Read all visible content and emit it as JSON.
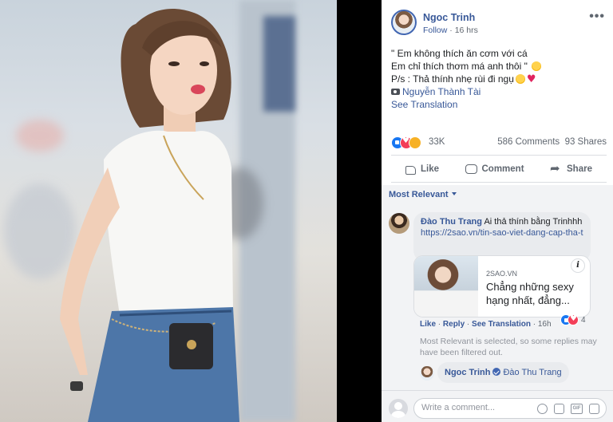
{
  "post": {
    "author": "Ngoc Trinh",
    "follow_label": "Follow",
    "separator": " · ",
    "time": "16 hrs",
    "more_label": "•••",
    "lines": [
      "\" Em không thích ăn cơm với cá",
      "Em chỉ thích thơm má anh thôi \"",
      "P/s : Thả thính nhẹ rùi đi ngụ"
    ],
    "photo_credit": "Nguyễn Thành Tài",
    "see_translation": "See Translation"
  },
  "reactions": {
    "count": "33K",
    "comments": "586 Comments",
    "shares": "93 Shares",
    "types": [
      "like",
      "love",
      "haha"
    ]
  },
  "actions": {
    "like": "Like",
    "comment": "Comment",
    "share": "Share"
  },
  "comments": {
    "sort_label": "Most Relevant",
    "items": [
      {
        "name": "Đào Thu Trang",
        "text": "Ai thả thính bằng Trinhhh",
        "url": "https://2sao.vn/tin-sao-viet-dang-cap-tha-thinh-cua-ngoc...",
        "preview": {
          "site": "2SAO.VN",
          "title": "Chẳng những sexy hạng nhất, đẳng..."
        },
        "actions": {
          "like": "Like",
          "reply": "Reply",
          "see_translation": "See Translation",
          "time": "16h"
        },
        "reaction_count": "4"
      }
    ],
    "filter_note": "Most Relevant is selected, so some replies may have been filtered out.",
    "reply": {
      "name": "Ngoc Trinh",
      "mention": "Đào Thu Trang"
    }
  },
  "composer": {
    "placeholder": "Write a comment...",
    "icons": [
      "emoji-icon",
      "camera-icon",
      "gif-icon",
      "sticker-icon"
    ]
  },
  "colors": {
    "link": "#385898",
    "secondary_text": "#606770",
    "comments_bg": "#f2f3f5",
    "like_blue": "#1877f2",
    "love_red": "#f33e58"
  }
}
